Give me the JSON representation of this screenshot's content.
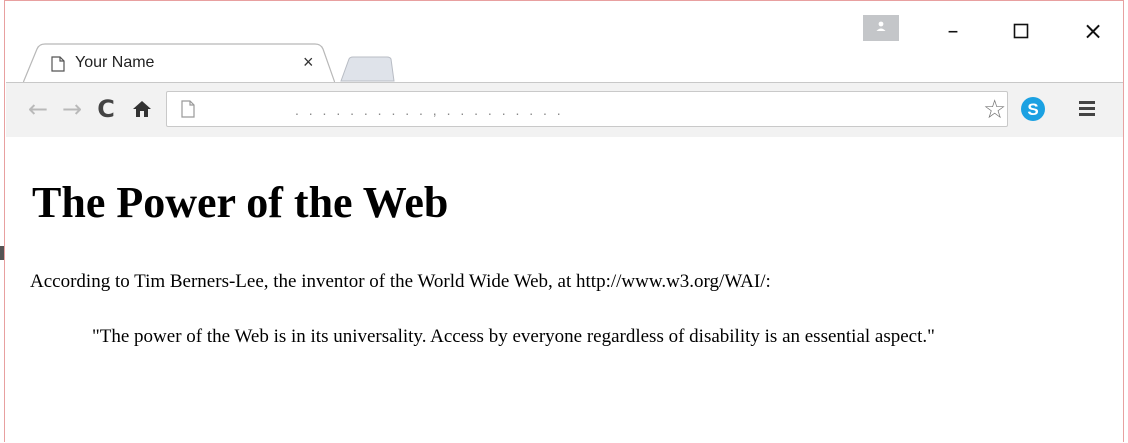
{
  "browser": {
    "tab": {
      "title": "Your Name",
      "close_glyph": "×"
    },
    "window_controls": {
      "minimize": "–",
      "maximize": "□",
      "close": "×"
    },
    "toolbar": {
      "back": "←",
      "forward": "→",
      "reload": "C",
      "address": {
        "value": ". . .   .   .   .   .   .   .   .   ,   .   .   .   .   .   .   .   .   .",
        "star": "☆"
      },
      "extension": "skype-icon",
      "menu": "menu-icon"
    },
    "colors": {
      "skype": "#1ba1e2",
      "profile": "#c4c6c9",
      "toolbar": "#f2f2f2",
      "window_border": "#e8a0a0"
    }
  },
  "page": {
    "heading": "The Power of the Web",
    "paragraph": "According to Tim Berners-Lee, the inventor of the World Wide Web, at http://www.w3.org/WAI/:",
    "quote": "\"The power of the Web is in its universality. Access by everyone regardless of disability is an essential aspect.\""
  }
}
